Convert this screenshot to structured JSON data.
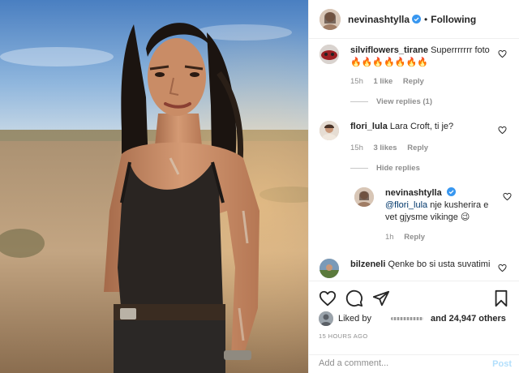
{
  "post": {
    "username": "nevinashtylla",
    "following_label": "Following",
    "separator": "•"
  },
  "comments": [
    {
      "username": "silviflowers_tirane",
      "text": "Superrrrrrr foto 🔥🔥🔥🔥🔥🔥🔥",
      "time": "15h",
      "likes": "1 like",
      "reply": "Reply",
      "thread": "View replies (1)"
    },
    {
      "username": "flori_lula",
      "text": "Lara Croft, ti je?",
      "time": "15h",
      "likes": "3 likes",
      "reply": "Reply",
      "thread": "Hide replies"
    },
    {
      "username": "bilzeneli",
      "text": "Qenke bo si usta suvatimi"
    }
  ],
  "reply": {
    "username": "nevinashtylla",
    "mention": "@flori_lula",
    "text": " nje kusherira e vet gjysme vikinge 😉",
    "time": "1h",
    "reply": "Reply"
  },
  "likes": {
    "prefix": "Liked by",
    "suffix": "and 24,947 others"
  },
  "timestamp": "15 HOURS AGO",
  "add_comment": {
    "placeholder": "Add a comment...",
    "post_label": "Post"
  },
  "icons": [
    "heart-icon",
    "comment-icon",
    "share-icon",
    "bookmark-icon",
    "verified-icon"
  ],
  "colors": {
    "text": "#262626",
    "secondary": "#8e8e8e",
    "verified": "#3897f0",
    "post_disabled": "#b2dffc",
    "border": "#efefef"
  }
}
